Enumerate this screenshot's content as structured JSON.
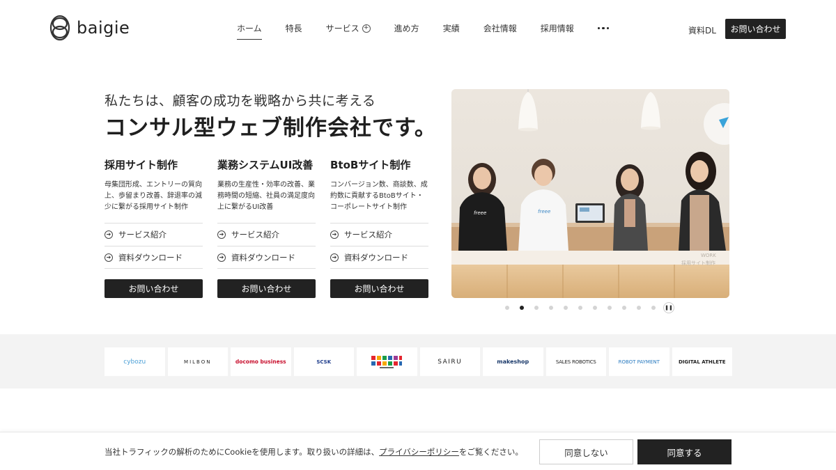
{
  "header": {
    "logo_text": "baigie",
    "nav": [
      {
        "label": "ホーム",
        "active": true
      },
      {
        "label": "特長"
      },
      {
        "label": "サービス",
        "has_plus": true
      },
      {
        "label": "進め方"
      },
      {
        "label": "実績"
      },
      {
        "label": "会社情報"
      },
      {
        "label": "採用情報"
      }
    ],
    "more_icon": "more-dots-icon",
    "doc_dl": "資料DL",
    "contact": "お問い合わせ"
  },
  "hero": {
    "subtitle": "私たちは、顧客の成功を戦略から共に考える",
    "title": "コンサル型ウェブ制作会社です。"
  },
  "services": [
    {
      "title": "採用サイト制作",
      "desc": "母集団形成、エントリーの質向上、歩留まり改善、辞退率の減少に繋がる採用サイト制作",
      "link1": "サービス紹介",
      "link2": "資料ダウンロード",
      "contact": "お問い合わせ"
    },
    {
      "title": "業務システムUI改善",
      "desc": "業務の生産性・効率の改善、業務時間の短縮、社員の満足度向上に繋がるUI改善",
      "link1": "サービス紹介",
      "link2": "資料ダウンロード",
      "contact": "お問い合わせ"
    },
    {
      "title": "BtoBサイト制作",
      "desc": "コンバージョン数、商談数、成約数に貢献するBtoBサイト・コーポレートサイト制作",
      "link1": "サービス紹介",
      "link2": "資料ダウンロード",
      "contact": "お問い合わせ"
    }
  ],
  "slider": {
    "dot_count": 12,
    "active_index": 1,
    "photo_caption_1": "WORK",
    "photo_caption_2": "採用サイト制作",
    "shirt_text": "freee"
  },
  "client_logos": [
    "cybozu",
    "MILBON",
    "docomo business",
    "SCSK",
    "Tokyu Media Group",
    "SAIRU",
    "makeshop",
    "SALES ROBOTICS",
    "ROBOT PAYMENT",
    "DIGITAL ATHLETE"
  ],
  "cookie": {
    "text_before": "当社トラフィックの解析のためにCookieを使用します。取り扱いの詳細は、",
    "link": "プライバシーポリシー",
    "text_after": "をご覧ください。",
    "decline": "同意しない",
    "accept": "同意する"
  },
  "colors": {
    "primary_dark": "#222222",
    "band_bg": "#f3f3f3"
  }
}
